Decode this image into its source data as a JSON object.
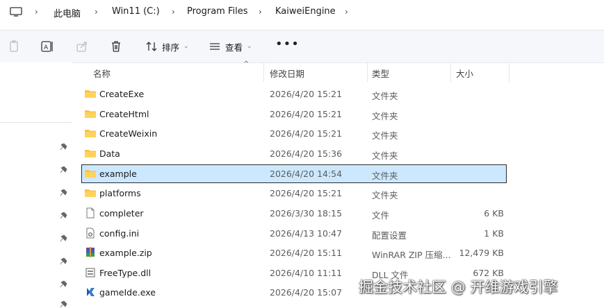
{
  "breadcrumb": {
    "items": [
      "此电脑",
      "Win11 (C:)",
      "Program Files",
      "KaiweiEngine"
    ]
  },
  "toolbar": {
    "sort_label": "排序",
    "view_label": "查看"
  },
  "columns": {
    "name": "名称",
    "date": "修改日期",
    "type": "类型",
    "size": "大小"
  },
  "files": [
    {
      "name": "CreateExe",
      "date": "2026/4/20 15:21",
      "type": "文件夹",
      "size": "",
      "icon": "folder-icon"
    },
    {
      "name": "CreateHtml",
      "date": "2026/4/20 15:21",
      "type": "文件夹",
      "size": "",
      "icon": "folder-icon"
    },
    {
      "name": "CreateWeixin",
      "date": "2026/4/20 15:21",
      "type": "文件夹",
      "size": "",
      "icon": "folder-icon"
    },
    {
      "name": "Data",
      "date": "2026/4/20 15:36",
      "type": "文件夹",
      "size": "",
      "icon": "folder-icon"
    },
    {
      "name": "example",
      "date": "2026/4/20 14:54",
      "type": "文件夹",
      "size": "",
      "icon": "folder-icon",
      "selected": true
    },
    {
      "name": "platforms",
      "date": "2026/4/20 15:21",
      "type": "文件夹",
      "size": "",
      "icon": "folder-icon"
    },
    {
      "name": "completer",
      "date": "2026/3/30 18:15",
      "type": "文件",
      "size": "6 KB",
      "icon": "file-icon"
    },
    {
      "name": "config.ini",
      "date": "2026/4/13 10:47",
      "type": "配置设置",
      "size": "1 KB",
      "icon": "settings-file-icon"
    },
    {
      "name": "example.zip",
      "date": "2026/4/20 15:11",
      "type": "WinRAR ZIP 压缩...",
      "size": "12,479 KB",
      "icon": "winrar-archive-icon"
    },
    {
      "name": "FreeType.dll",
      "date": "2026/4/10 11:11",
      "type": "DLL 文件",
      "size": "672 KB",
      "icon": "dll-file-icon"
    },
    {
      "name": "gameIde.exe",
      "date": "2026/4/20 15:07",
      "type": "",
      "size": "",
      "icon": "app-exe-icon"
    }
  ],
  "watermark": "掘金技术社区 @ 开维游戏引擎",
  "colors": {
    "folder": "#f6c24b",
    "selected_row": "#cce8ff",
    "toolbar_bg": "#f5f7fa"
  }
}
